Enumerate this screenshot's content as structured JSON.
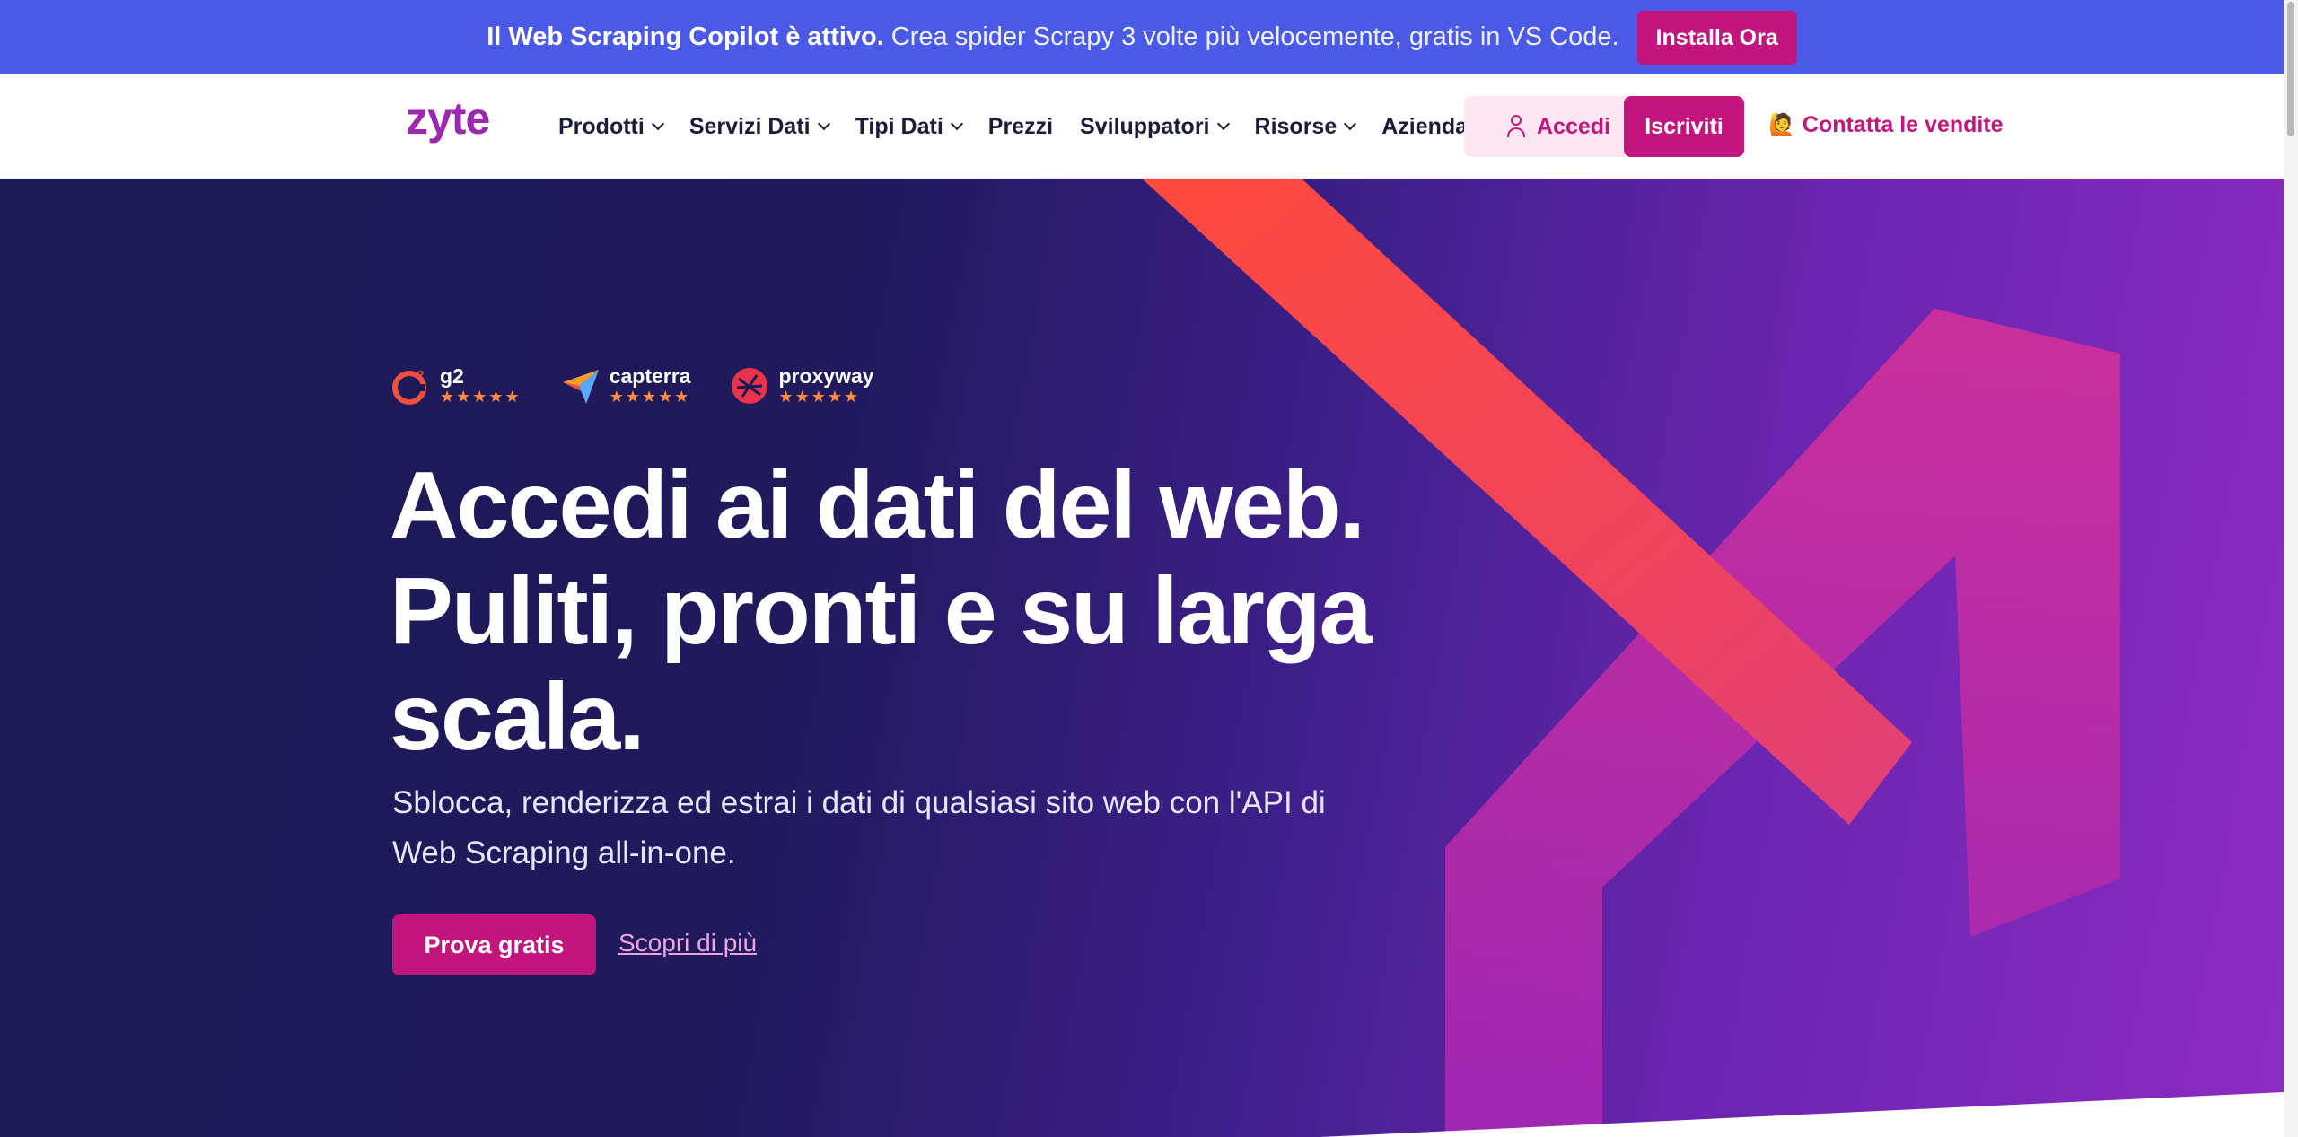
{
  "banner": {
    "strong_text": "Il Web Scraping Copilot è attivo.",
    "text": "Crea spider Scrapy 3 volte più velocemente, gratis in VS Code.",
    "install_label": "Installa Ora"
  },
  "header": {
    "logo": "zyte",
    "nav": [
      {
        "label": "Prodotti",
        "dropdown": true
      },
      {
        "label": "Servizi Dati",
        "dropdown": true
      },
      {
        "label": "Tipi Dati",
        "dropdown": true
      },
      {
        "label": "Prezzi",
        "dropdown": false
      },
      {
        "label": "Sviluppatori",
        "dropdown": true
      },
      {
        "label": "Risorse",
        "dropdown": true
      },
      {
        "label": "Azienda",
        "dropdown": true
      }
    ],
    "login_label": "Accedi",
    "signup_label": "Iscriviti",
    "contact_emoji": "🙋",
    "contact_label": "Contatta le vendite"
  },
  "hero": {
    "ratings": [
      {
        "name": "g2",
        "stars": "★★★★★",
        "icon": "g2-logo-icon"
      },
      {
        "name": "capterra",
        "stars": "★★★★★",
        "icon": "capterra-logo-icon"
      },
      {
        "name": "proxyway",
        "stars": "★★★★★",
        "icon": "proxyway-logo-icon"
      }
    ],
    "headline_line1": "Accedi ai dati del web.",
    "headline_line2": "Puliti, pronti e su larga",
    "headline_line3": "scala.",
    "subtitle": "Sblocca, renderizza ed estrai i dati di qualsiasi sito web con l'API di Web Scraping all-in-one.",
    "cta_label": "Prova gratis",
    "learn_more_label": "Scopri di più"
  },
  "colors": {
    "banner_bg": "#4b5ae6",
    "brand_magenta": "#c2157e",
    "logo_purple": "#9c27b0",
    "hero_dark": "#1c1a56",
    "accent_red": "#ff4a3d"
  }
}
